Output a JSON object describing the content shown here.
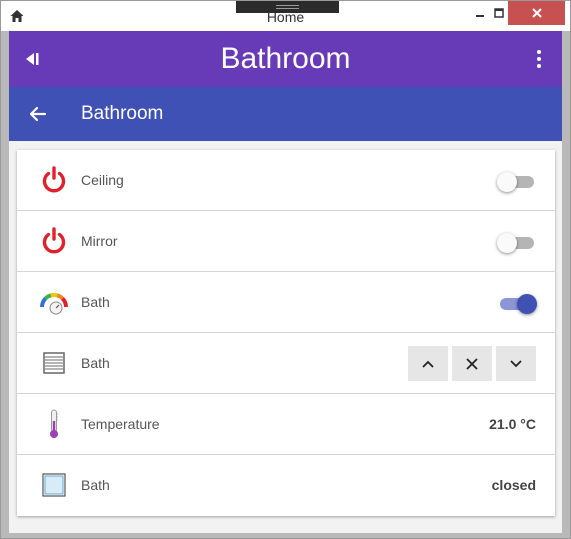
{
  "window": {
    "title": "Home"
  },
  "appbar": {
    "title": "Bathroom"
  },
  "subheader": {
    "title": "Bathroom"
  },
  "items": [
    {
      "label": "Ceiling",
      "icon": "power-icon",
      "state": "off"
    },
    {
      "label": "Mirror",
      "icon": "power-icon",
      "state": "off"
    },
    {
      "label": "Bath",
      "icon": "dimmer-gauge-icon",
      "state": "on"
    },
    {
      "label": "Bath",
      "icon": "rollershutter-icon"
    },
    {
      "label": "Temperature",
      "icon": "thermometer-icon",
      "value": "21.0 °C"
    },
    {
      "label": "Bath",
      "icon": "window-contact-icon",
      "value": "closed"
    }
  ],
  "colors": {
    "appbar": "#673ab7",
    "subheader": "#3f51b5",
    "switch_on": "#3f51b5",
    "power_icon": "#e0202b",
    "close_button": "#c75050"
  }
}
